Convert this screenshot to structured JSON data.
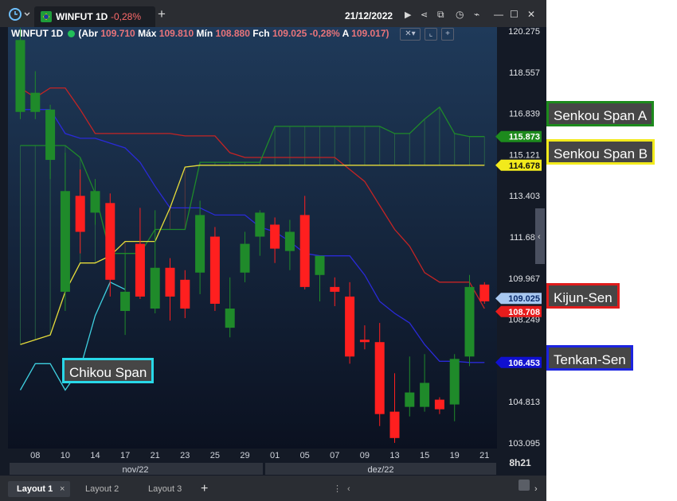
{
  "toolbar": {
    "symbol_tab": "WINFUT 1D",
    "tab_change": "-0,28%",
    "add_tab": "+",
    "date": "21/12/2022",
    "window_controls": [
      "▶",
      "⋖",
      "⧉",
      "◷",
      "⌁",
      "—",
      "☐",
      "✕"
    ]
  },
  "info_line": {
    "symbol": "WINFUT 1D",
    "abr_label": "(Abr",
    "abr_value": "109.710",
    "max_label": "Máx",
    "max_value": "109.810",
    "min_label": "Mín",
    "min_value": "108.880",
    "close_label": "Fch",
    "close_value": "109.025 -0,28%",
    "a_label": "A",
    "a_value": "109.017)"
  },
  "time_label": "8h21",
  "month_labels": [
    "nov/22",
    "dez/22"
  ],
  "bottom_tabs": [
    "Layout 1",
    "Layout 2",
    "Layout 3"
  ],
  "bottom_add": "+",
  "annotations": {
    "senkou_a": "Senkou Span A",
    "senkou_b": "Senkou Span B",
    "kijun": "Kijun-Sen",
    "tenkan": "Tenkan-Sen",
    "chikou": "Chikou Span"
  },
  "colors": {
    "up": "#1f8a2a",
    "down": "#ff1f1f",
    "tenkan": "#2a2ad8",
    "kijun": "#c42424",
    "senkou_a": "#1f8a2a",
    "senkou_b": "#e6dc3a",
    "chikou": "#3fd0e0"
  },
  "chart_data": {
    "type": "candlestick",
    "ylim": [
      103095,
      120275
    ],
    "y_ticks": [
      120275,
      118557,
      116839,
      115121,
      113403,
      111685,
      109967,
      108249,
      104813,
      103095
    ],
    "y_tick_labels": [
      "120.275",
      "118.557",
      "116.839",
      "115.121",
      "113.403",
      "111.685",
      "109.967",
      "108.249",
      "104.813",
      "103.095"
    ],
    "x_tick_labels": [
      "08",
      "10",
      "14",
      "17",
      "21",
      "23",
      "25",
      "29",
      "01",
      "05",
      "07",
      "09",
      "13",
      "15",
      "19",
      "21"
    ],
    "x_tick_index": [
      1,
      3,
      5,
      7,
      9,
      11,
      13,
      15,
      17,
      19,
      21,
      23,
      25,
      27,
      29,
      31
    ],
    "candles": [
      {
        "o": 116.9,
        "h": 120.4,
        "l": 116.6,
        "c": 119.9
      },
      {
        "o": 116.9,
        "h": 118.6,
        "l": 116.6,
        "c": 117.7
      },
      {
        "o": 114.9,
        "h": 117.2,
        "l": 114.1,
        "c": 117.0
      },
      {
        "o": 109.4,
        "h": 115.2,
        "l": 108.6,
        "c": 113.6
      },
      {
        "o": 113.4,
        "h": 114.5,
        "l": 111.0,
        "c": 111.9
      },
      {
        "o": 112.7,
        "h": 114.1,
        "l": 112.2,
        "c": 113.6
      },
      {
        "o": 113.1,
        "h": 113.5,
        "l": 109.2,
        "c": 109.9
      },
      {
        "o": 108.6,
        "h": 111.0,
        "l": 107.6,
        "c": 109.4
      },
      {
        "o": 111.4,
        "h": 112.9,
        "l": 109.1,
        "c": 109.2
      },
      {
        "o": 108.7,
        "h": 112.8,
        "l": 108.5,
        "c": 110.4
      },
      {
        "o": 110.4,
        "h": 110.8,
        "l": 108.2,
        "c": 109.2
      },
      {
        "o": 109.9,
        "h": 110.3,
        "l": 108.3,
        "c": 108.7
      },
      {
        "o": 110.2,
        "h": 113.2,
        "l": 109.3,
        "c": 112.6
      },
      {
        "o": 111.7,
        "h": 112.1,
        "l": 108.6,
        "c": 108.9
      },
      {
        "o": 107.9,
        "h": 110.0,
        "l": 107.5,
        "c": 108.7
      },
      {
        "o": 110.2,
        "h": 111.9,
        "l": 109.8,
        "c": 111.4
      },
      {
        "o": 111.7,
        "h": 112.8,
        "l": 110.9,
        "c": 112.7
      },
      {
        "o": 112.2,
        "h": 112.5,
        "l": 110.6,
        "c": 111.2
      },
      {
        "o": 111.1,
        "h": 112.4,
        "l": 110.3,
        "c": 111.9
      },
      {
        "o": 112.6,
        "h": 113.4,
        "l": 109.5,
        "c": 109.6
      },
      {
        "o": 110.1,
        "h": 110.5,
        "l": 109.0,
        "c": 110.9
      },
      {
        "o": 109.6,
        "h": 110.0,
        "l": 108.8,
        "c": 109.4
      },
      {
        "o": 109.2,
        "h": 109.8,
        "l": 106.4,
        "c": 106.7
      },
      {
        "o": 107.4,
        "h": 108.0,
        "l": 107.0,
        "c": 107.3
      },
      {
        "o": 107.3,
        "h": 108.1,
        "l": 103.8,
        "c": 104.3
      },
      {
        "o": 104.4,
        "h": 106.0,
        "l": 103.1,
        "c": 103.3
      },
      {
        "o": 104.6,
        "h": 106.7,
        "l": 104.2,
        "c": 105.2
      },
      {
        "o": 104.6,
        "h": 106.8,
        "l": 104.4,
        "c": 105.6
      },
      {
        "o": 104.9,
        "h": 105.0,
        "l": 104.3,
        "c": 104.5
      },
      {
        "o": 104.7,
        "h": 106.8,
        "l": 104.0,
        "c": 106.6
      },
      {
        "o": 106.7,
        "h": 110.1,
        "l": 106.3,
        "c": 109.6
      },
      {
        "o": 109.7,
        "h": 109.8,
        "l": 108.9,
        "c": 109.0
      }
    ],
    "series": [
      {
        "name": "Tenkan-Sen",
        "values": [
          117.0,
          117.0,
          117.0,
          116.0,
          115.8,
          115.8,
          115.6,
          115.4,
          114.8,
          113.8,
          112.9,
          112.9,
          112.9,
          112.6,
          112.6,
          112.6,
          112.1,
          111.9,
          111.5,
          111.0,
          110.9,
          110.9,
          110.9,
          110.1,
          109.0,
          108.5,
          108.1,
          107.2,
          106.5,
          106.5,
          106.45,
          106.45
        ]
      },
      {
        "name": "Kijun-Sen",
        "values": [
          117.9,
          117.5,
          117.9,
          117.9,
          117.0,
          116.0,
          116.0,
          116.0,
          116.0,
          116.0,
          116.0,
          115.9,
          115.9,
          115.9,
          115.2,
          115.0,
          115.0,
          115.0,
          115.0,
          115.0,
          115.0,
          115.0,
          114.5,
          114.0,
          113.0,
          112.0,
          111.3,
          110.2,
          109.8,
          109.8,
          109.8,
          108.7
        ]
      },
      {
        "name": "Senkou Span A",
        "values": [
          115.5,
          115.5,
          115.5,
          115.5,
          115.0,
          113.5,
          111.0,
          111.0,
          111.0,
          112.0,
          112.0,
          112.0,
          114.8,
          114.8,
          114.8,
          114.8,
          114.8,
          116.3,
          116.3,
          116.3,
          116.3,
          116.3,
          116.3,
          116.3,
          116.3,
          116.0,
          116.0,
          116.6,
          117.1,
          116.0,
          115.873,
          115.873
        ]
      },
      {
        "name": "Senkou Span B",
        "values": [
          107.2,
          107.4,
          107.6,
          109.4,
          110.6,
          110.6,
          110.9,
          111.5,
          111.5,
          111.5,
          112.9,
          114.6,
          114.678,
          114.678,
          114.678,
          114.678,
          114.678,
          114.678,
          114.678,
          114.678,
          114.678,
          114.678,
          114.678,
          114.678,
          114.678,
          114.678,
          114.678,
          114.678,
          114.678,
          114.678,
          114.678,
          114.678
        ]
      },
      {
        "name": "Chikou Span",
        "values": [
          105.3,
          106.4,
          106.4,
          105.3,
          106.2,
          108.4,
          109.8,
          109.5
        ]
      }
    ],
    "price_markers": [
      {
        "label": "115.873",
        "value": 115.873
      },
      {
        "label": "114.678",
        "value": 114.678
      },
      {
        "label": "109.025",
        "value": 109.025
      },
      {
        "label": "108.708",
        "value": 108.708
      },
      {
        "label": "106.453",
        "value": 106.453
      }
    ]
  }
}
